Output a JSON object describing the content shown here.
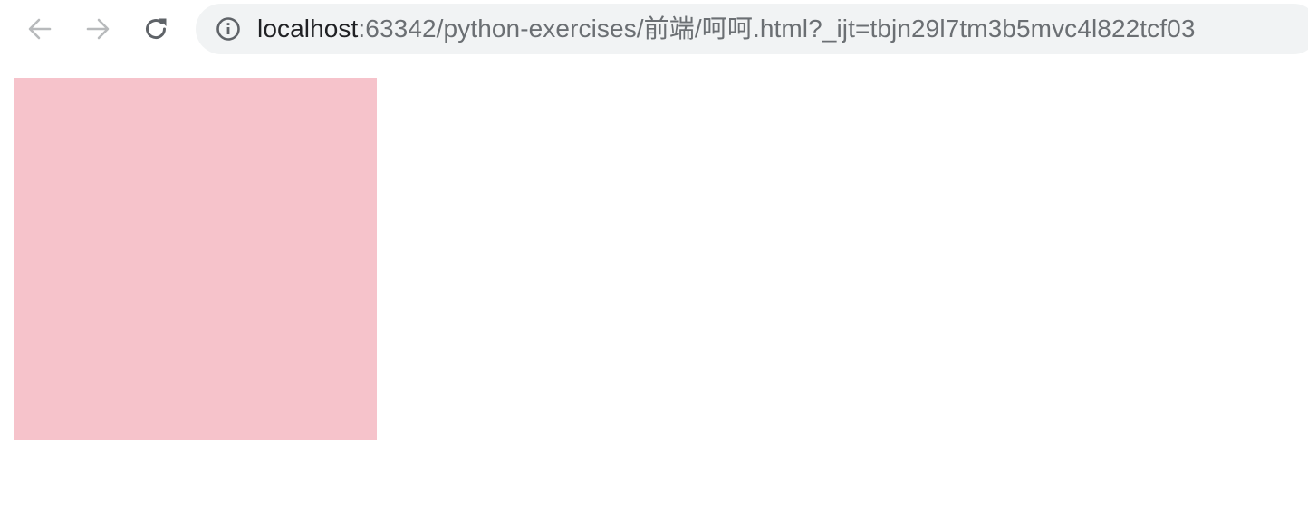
{
  "browser": {
    "url_host": "localhost",
    "url_rest": ":63342/python-exercises/前端/呵呵.html?_ijt=tbjn29l7tm3b5mvc4l822tcf03",
    "icons": {
      "back": "arrow-left-icon",
      "forward": "arrow-right-icon",
      "reload": "reload-icon",
      "site_info": "info-icon"
    }
  },
  "page": {
    "box_color": "#f6c3cb",
    "background": "#ffffff"
  }
}
